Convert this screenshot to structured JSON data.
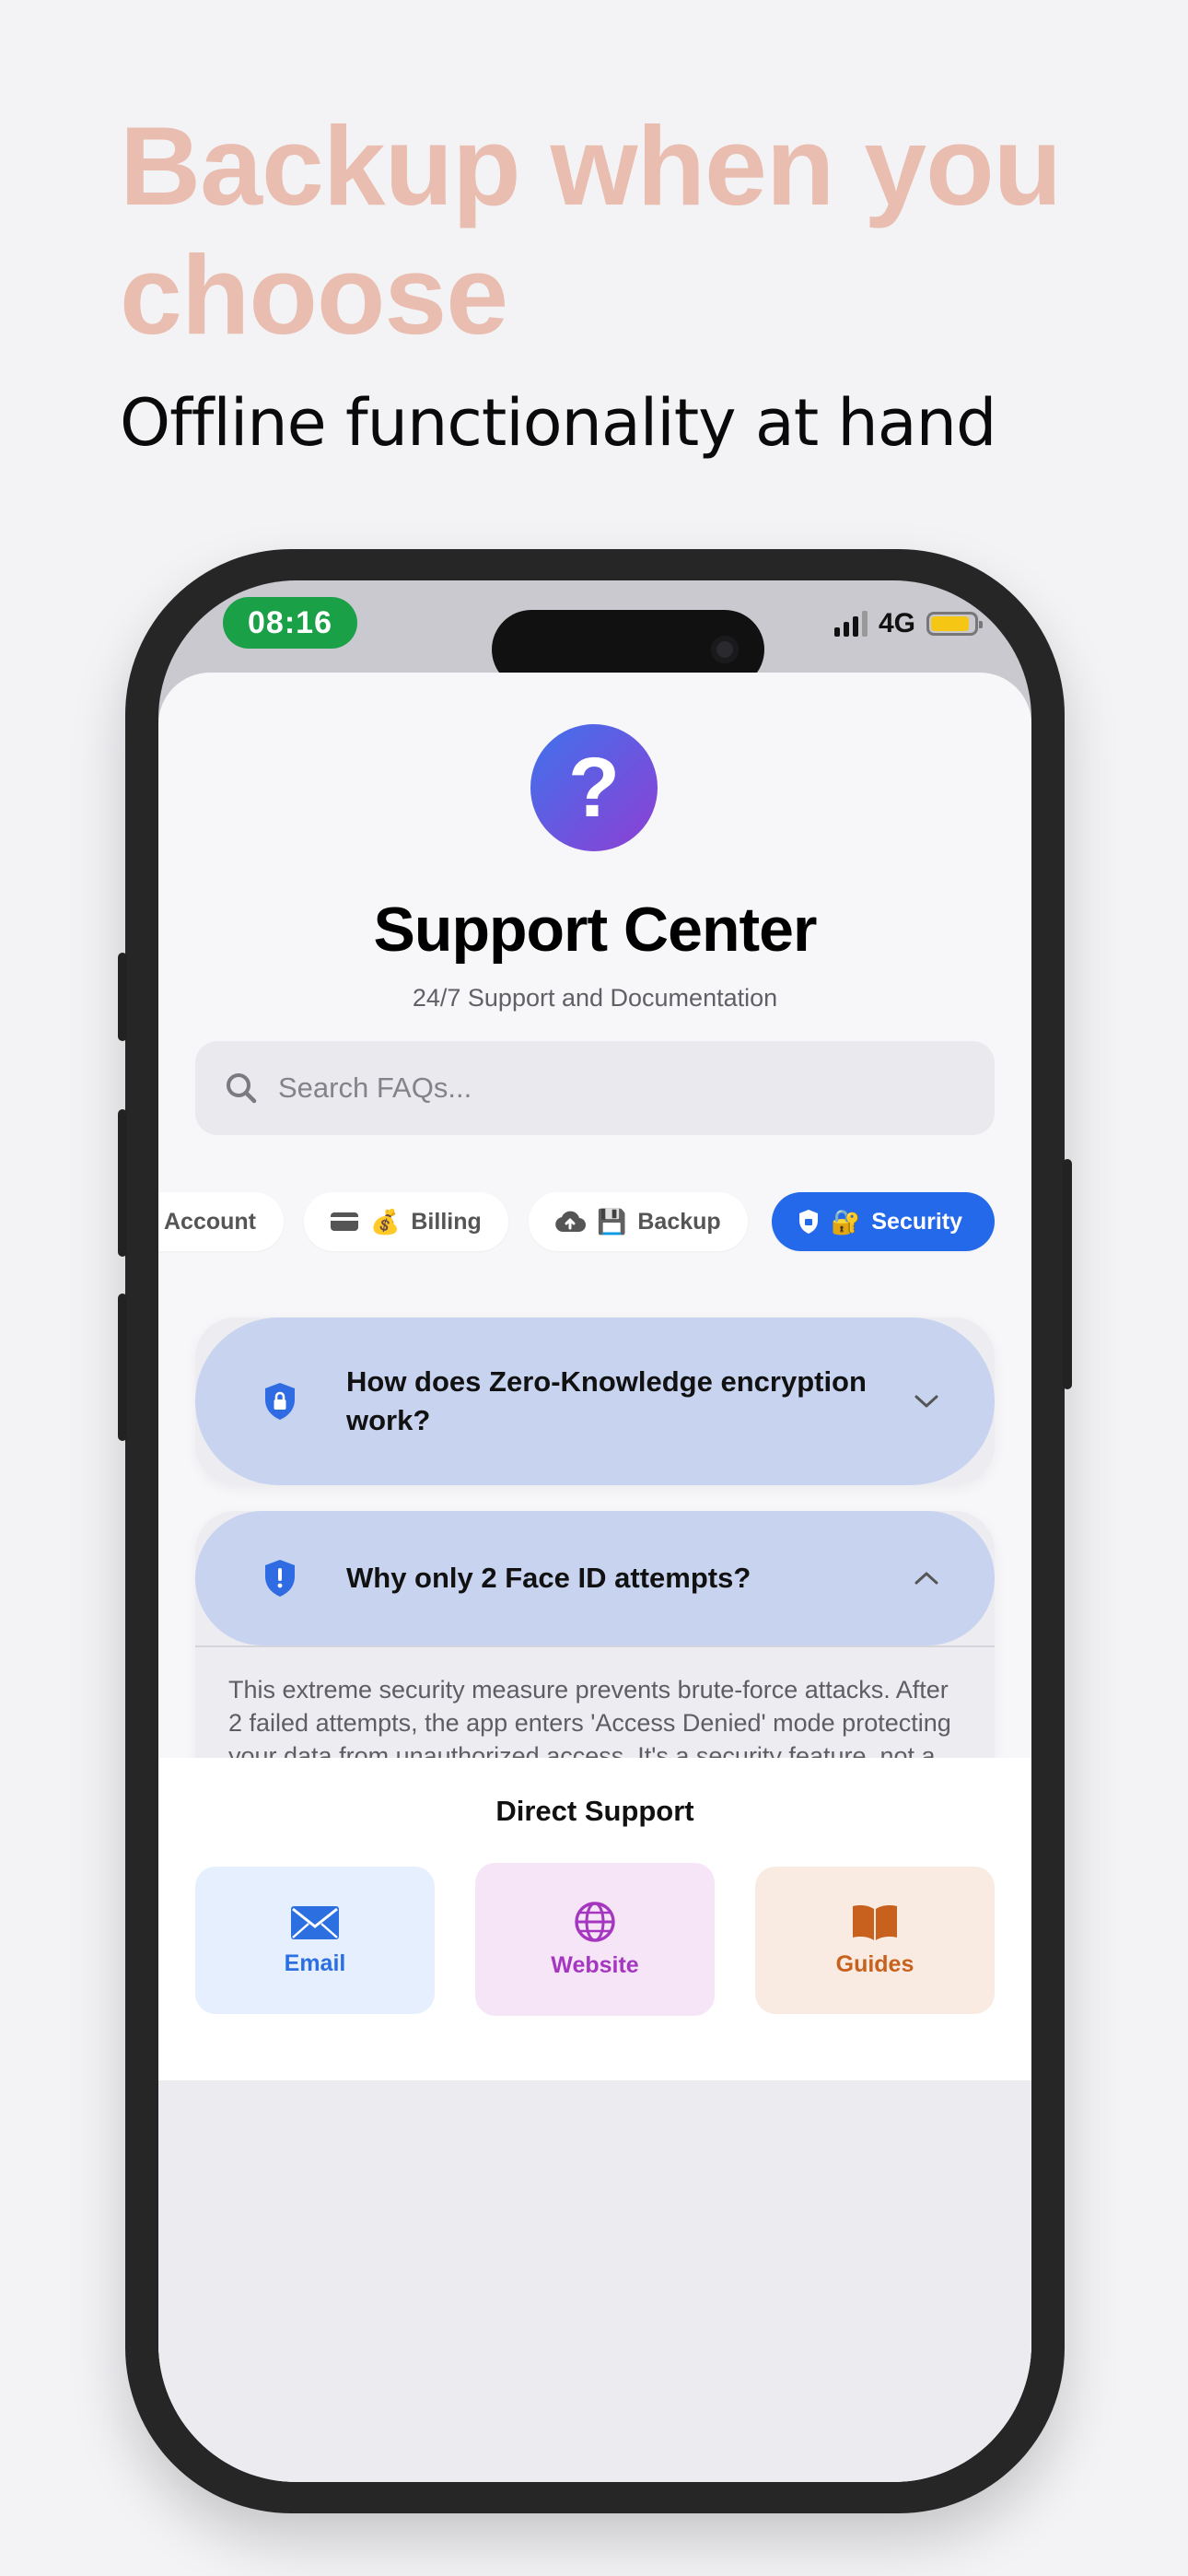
{
  "promo": {
    "headline": "Backup when you choose",
    "subheadline": "Offline functionality at hand"
  },
  "status_bar": {
    "time": "08:16",
    "network": "4G",
    "battery_level": 0.9
  },
  "header": {
    "icon_glyph": "?",
    "title": "Support Center",
    "subtitle": "24/7 Support and Documentation"
  },
  "search": {
    "placeholder": "Search FAQs..."
  },
  "categories": [
    {
      "label": "Account",
      "icon": "person-icon",
      "emoji": "",
      "active": false
    },
    {
      "label": "Billing",
      "icon": "credit-card-icon",
      "emoji": "💰",
      "active": false
    },
    {
      "label": "Backup",
      "icon": "cloud-upload-icon",
      "emoji": "💾",
      "active": false
    },
    {
      "label": "Security",
      "icon": "shield-icon",
      "emoji": "🔐",
      "active": true
    }
  ],
  "faqs": [
    {
      "question": "How does Zero-Knowledge encryption work?",
      "icon": "shield-lock-icon",
      "expanded": false
    },
    {
      "question": "Why only 2 Face ID attempts?",
      "icon": "shield-alert-icon",
      "expanded": true,
      "answer": "This extreme security measure prevents brute-force attacks. After 2 failed attempts, the app enters 'Access Denied' mode protecting your data from unauthorized access. It's a security feature, not a bug."
    }
  ],
  "direct_support": {
    "title": "Direct Support",
    "options": [
      {
        "label": "Email",
        "icon": "envelope-icon",
        "color": "#2b6fe0"
      },
      {
        "label": "Website",
        "icon": "globe-icon",
        "color": "#a536bf"
      },
      {
        "label": "Guides",
        "icon": "book-icon",
        "color": "#c8611d"
      }
    ]
  },
  "colors": {
    "accent": "#2369ea",
    "headline": "#e9bdb0",
    "status_time_bg": "#1aa147"
  }
}
